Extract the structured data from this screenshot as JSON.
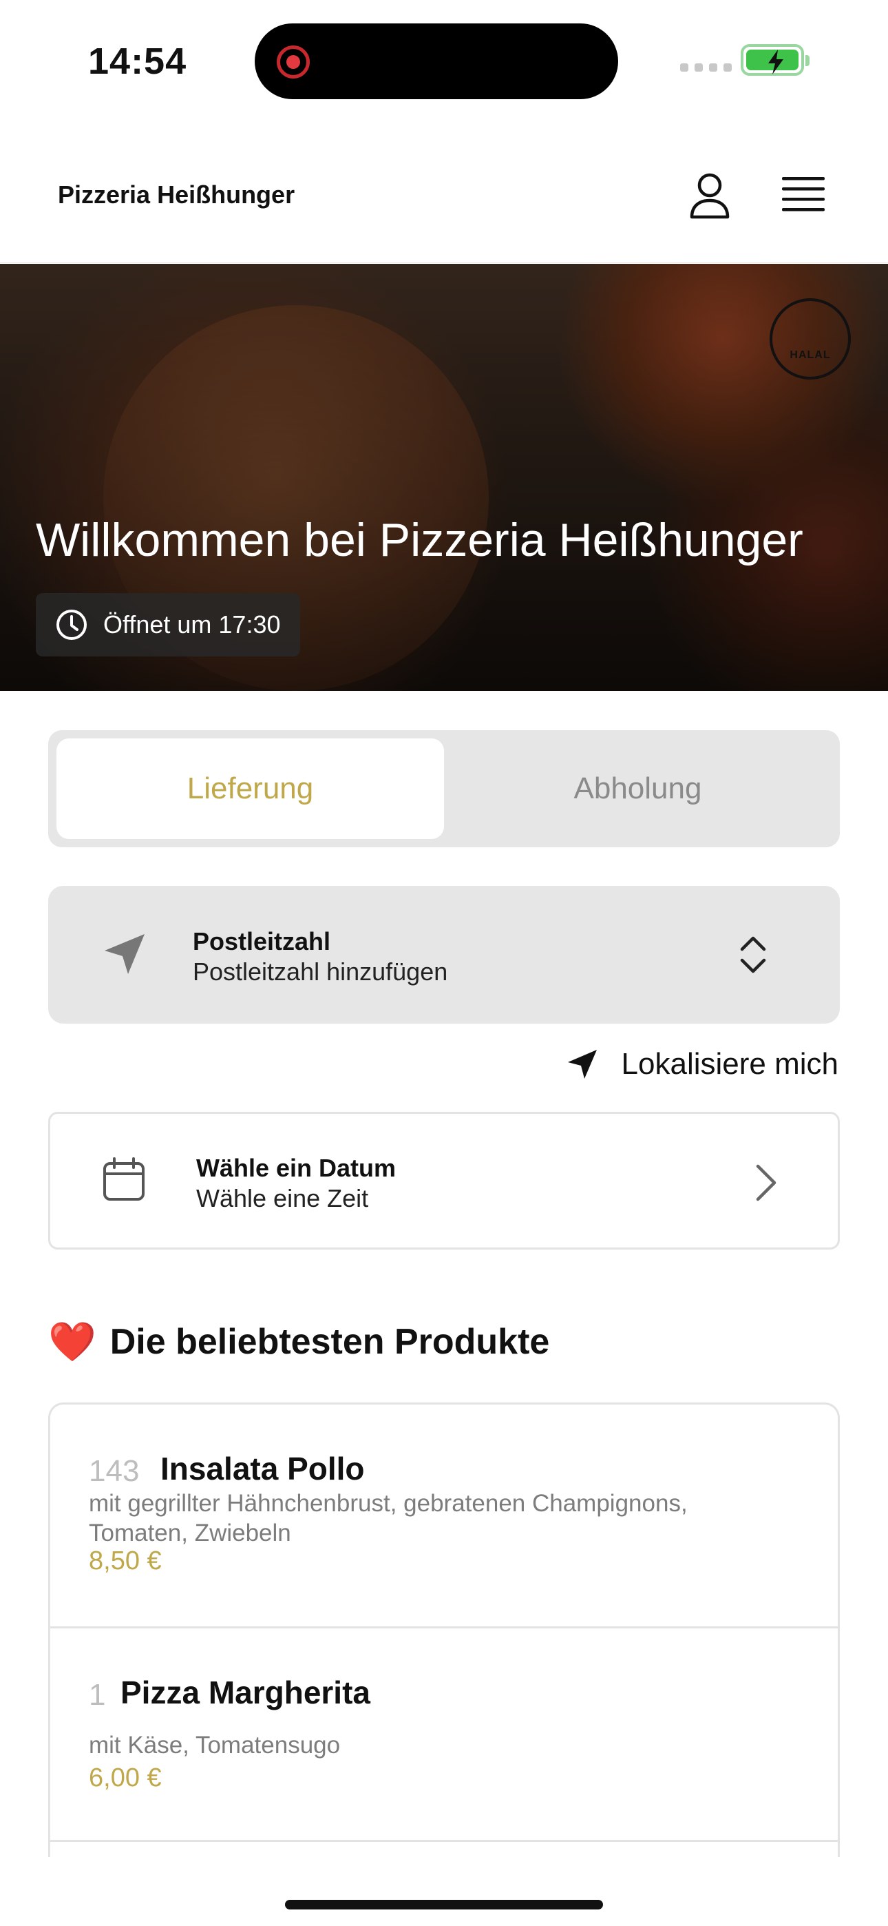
{
  "status_bar": {
    "time": "14:54",
    "battery_color": "#3fc24a",
    "recording_indicator_color": "#e23a3f"
  },
  "header": {
    "brand": "Pizzeria Heißhunger",
    "account_icon": "user-icon",
    "menu_icon": "hamburger-menu-icon"
  },
  "hero": {
    "title": "Willkommen bei Pizzeria Heißhunger",
    "opening_badge": "Öffnet um 17:30",
    "halal_badge": "HALAL"
  },
  "order_mode": {
    "options": [
      "Lieferung",
      "Abholung"
    ],
    "selected": "Lieferung",
    "accent_color": "#c0a84a"
  },
  "postal": {
    "title": "Postleitzahl",
    "subtitle": "Postleitzahl hinzufügen"
  },
  "locate": {
    "label": "Lokalisiere mich"
  },
  "date_picker": {
    "title": "Wähle ein Datum",
    "subtitle": "Wähle eine Zeit"
  },
  "popular": {
    "title": "Die beliebtesten Produkte",
    "emoji": "❤️",
    "items": [
      {
        "number": "143",
        "name": "Insalata Pollo",
        "description": "mit gegrillter Hähnchenbrust, gebratenen Champignons, Tomaten, Zwiebeln",
        "price": "8,50 €"
      },
      {
        "number": "1",
        "name": "Pizza Margherita",
        "description": "mit Käse, Tomatensugo",
        "price": "6,00 €"
      }
    ]
  }
}
